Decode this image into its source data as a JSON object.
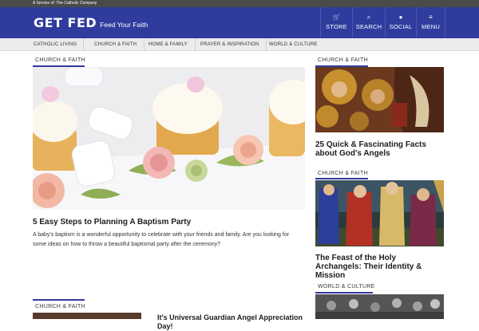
{
  "topbar": {
    "text": "A Service of: The Catholic Company"
  },
  "brand": {
    "logo": "GET FED",
    "tagline": "Feed Your Faith"
  },
  "nav": [
    {
      "icon": "cart-icon",
      "glyph": "🛒",
      "label": "STORE"
    },
    {
      "icon": "search-icon",
      "glyph": "⌕",
      "label": "SEARCH"
    },
    {
      "icon": "user-icon",
      "glyph": "●",
      "label": "SOCIAL"
    },
    {
      "icon": "menu-icon",
      "glyph": "≡",
      "label": "MENU"
    }
  ],
  "categories": [
    "CATHOLIC LIVING",
    "CHURCH & FAITH",
    "HOME & FAMILY",
    "PRAYER & INSPIRATION",
    "WORLD & CULTURE"
  ],
  "main_article": {
    "section": "CHURCH & FAITH",
    "headline": "5 Easy Steps to Planning A Baptism Party",
    "excerpt": "A baby's baptism is a wonderful opportunity to celebrate with your friends and family. Are you looking for some ideas on how to throw a beautiful baptismal party after the ceremony?"
  },
  "second_article": {
    "section": "CHURCH & FAITH",
    "headline": "It's Universal Guardian Angel Appreciation Day!"
  },
  "sidebar": [
    {
      "section": "CHURCH & FAITH",
      "headline": "25 Quick & Fascinating Facts about God's Angels"
    },
    {
      "section": "CHURCH & FAITH",
      "headline": "The Feast of the Holy Archangels: Their Identity & Mission"
    },
    {
      "section": "WORLD & CULTURE",
      "headline": ""
    }
  ],
  "colors": {
    "brand_blue": "#2f3c9e",
    "topbar": "#4a4a4a",
    "category_bar": "#ececec"
  }
}
